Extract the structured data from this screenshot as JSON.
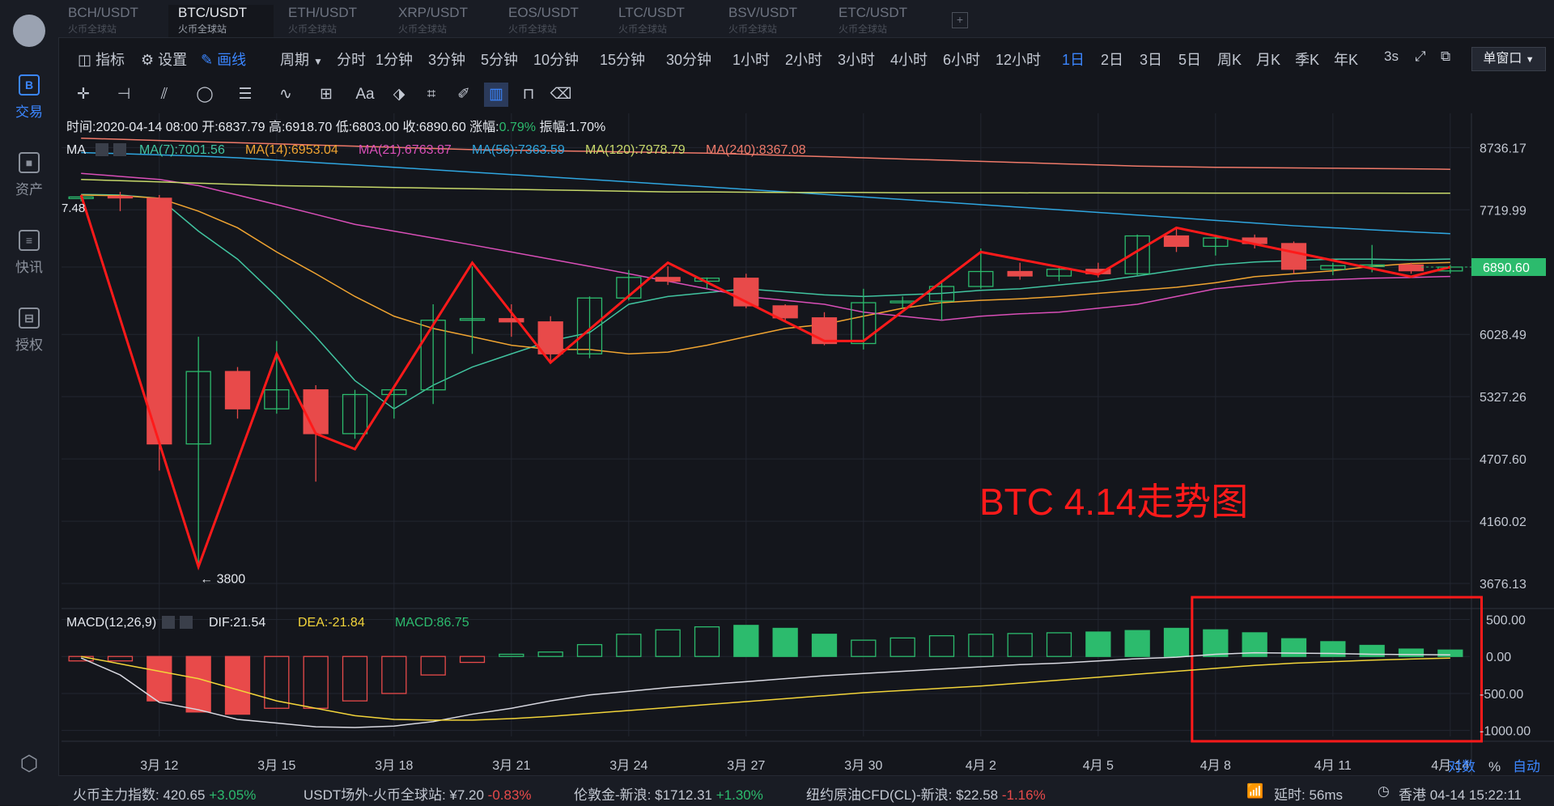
{
  "sidebar": {
    "items": [
      {
        "label": "交易",
        "icon": "B"
      },
      {
        "label": "资产",
        "icon": "■"
      },
      {
        "label": "快讯",
        "icon": "≡"
      },
      {
        "label": "授权",
        "icon": "⊟"
      }
    ]
  },
  "tabs": [
    {
      "symbol": "BCH/USDT",
      "sub": "火币全球站"
    },
    {
      "symbol": "BTC/USDT",
      "sub": "火币全球站"
    },
    {
      "symbol": "ETH/USDT",
      "sub": "火币全球站"
    },
    {
      "symbol": "XRP/USDT",
      "sub": "火币全球站"
    },
    {
      "symbol": "EOS/USDT",
      "sub": "火币全球站"
    },
    {
      "symbol": "LTC/USDT",
      "sub": "火币全球站"
    },
    {
      "symbol": "BSV/USDT",
      "sub": "火币全球站"
    },
    {
      "symbol": "ETC/USDT",
      "sub": "火币全球站"
    }
  ],
  "toolbar": {
    "indicator": "指标",
    "settings": "设置",
    "draw": "画线",
    "period": "周期",
    "periods": [
      "分时",
      "1分钟",
      "3分钟",
      "5分钟",
      "10分钟",
      "15分钟",
      "30分钟",
      "1小时",
      "2小时",
      "3小时",
      "4小时",
      "6小时",
      "12小时",
      "1日",
      "2日",
      "3日",
      "5日",
      "周K",
      "月K",
      "季K",
      "年K"
    ],
    "active_period": "1日",
    "refresh": "3s",
    "window": "单窗口"
  },
  "ohlc": {
    "time_label": "时间:",
    "time": "2020-04-14 08:00",
    "open_label": "开:",
    "open": "6837.79",
    "high_label": "高:",
    "high": "6918.70",
    "low_label": "低:",
    "low": "6803.00",
    "close_label": "收:",
    "close": "6890.60",
    "change_label": "涨幅:",
    "change": "0.79%",
    "amp_label": "振幅:",
    "amp": "1.70%"
  },
  "ma_legend": {
    "label": "MA",
    "items": [
      {
        "text": "MA(7):7001.56",
        "color": "#41c4a0"
      },
      {
        "text": "MA(14):6953.04",
        "color": "#f0a431"
      },
      {
        "text": "MA(21):6763.87",
        "color": "#d94fb8"
      },
      {
        "text": "MA(56):7363.59",
        "color": "#2fa6e0"
      },
      {
        "text": "MA(120):7978.79",
        "color": "#c7d86a"
      },
      {
        "text": "MA(240):8367.08",
        "color": "#f07a6a"
      }
    ]
  },
  "macd_legend": {
    "label": "MACD(12,26,9)",
    "dif": "DIF:21.54",
    "dea": "DEA:-21.84",
    "macd": "MACD:86.75"
  },
  "annotation": {
    "title": "BTC 4.14走势图",
    "low_mark": "← 3800",
    "left_price": "7.48"
  },
  "price_axis": [
    "8736.17",
    "7719.99",
    "6890.60",
    "6028.49",
    "5327.26",
    "4707.60",
    "4160.02",
    "3676.13"
  ],
  "current_price": "6890.60",
  "macd_axis": [
    "500.00",
    "0.00",
    "-500.00",
    "-1000.00"
  ],
  "date_axis": [
    "3月 12",
    "3月 15",
    "3月 18",
    "3月 21",
    "3月 24",
    "3月 27",
    "3月 30",
    "4月 2",
    "4月 5",
    "4月 8",
    "4月 11",
    "4月 14"
  ],
  "axis_controls": {
    "log": "对数",
    "pct": "%",
    "auto": "自动"
  },
  "footer": {
    "items": [
      {
        "label": "火币主力指数:",
        "value": "420.65",
        "change": "+3.05%",
        "dir": "pos"
      },
      {
        "label": "USDT场外-火币全球站:",
        "value": "¥7.20",
        "change": "-0.83%",
        "dir": "neg"
      },
      {
        "label": "伦敦金-新浪:",
        "value": "$1712.31",
        "change": "+1.30%",
        "dir": "pos"
      },
      {
        "label": "纽约原油CFD(CL)-新浪:",
        "value": "$22.58",
        "change": "-1.16%",
        "dir": "neg"
      }
    ],
    "latency": "延时: 56ms",
    "clock": "香港 04-14 15:22:11"
  },
  "colors": {
    "up": "#2cbb6d",
    "down": "#e84a4a",
    "accent": "#3b86ff",
    "annotation": "#ff1a1a"
  },
  "chart_data": {
    "type": "candlestick",
    "title": "BTC 4.14走势图",
    "ylim": [
      3676.13,
      8736.17
    ],
    "dates": [
      "3-10",
      "3-11",
      "3-12",
      "3-13",
      "3-14",
      "3-15",
      "3-16",
      "3-17",
      "3-18",
      "3-19",
      "3-20",
      "3-21",
      "3-22",
      "3-23",
      "3-24",
      "3-25",
      "3-26",
      "3-27",
      "3-28",
      "3-29",
      "3-30",
      "3-31",
      "4-1",
      "4-2",
      "4-3",
      "4-4",
      "4-5",
      "4-6",
      "4-7",
      "4-8",
      "4-9",
      "4-10",
      "4-11",
      "4-12",
      "4-13",
      "4-14"
    ],
    "ohlc": [
      [
        7900,
        7950,
        7850,
        7920
      ],
      [
        7930,
        8000,
        7700,
        7920
      ],
      [
        7900,
        7950,
        4600,
        4850
      ],
      [
        4850,
        6000,
        3800,
        5600
      ],
      [
        5600,
        5650,
        5100,
        5200
      ],
      [
        5200,
        5950,
        5150,
        5400
      ],
      [
        5400,
        5450,
        4500,
        4950
      ],
      [
        4950,
        5400,
        4900,
        5350
      ],
      [
        5350,
        5450,
        5100,
        5400
      ],
      [
        5400,
        6400,
        5250,
        6200
      ],
      [
        6200,
        6900,
        5800,
        6220
      ],
      [
        6220,
        6400,
        6000,
        6180
      ],
      [
        6180,
        6250,
        5700,
        5800
      ],
      [
        5800,
        6500,
        5750,
        6480
      ],
      [
        6480,
        6850,
        6450,
        6750
      ],
      [
        6750,
        6900,
        6650,
        6700
      ],
      [
        6700,
        6750,
        6600,
        6740
      ],
      [
        6740,
        6800,
        6350,
        6380
      ],
      [
        6380,
        6400,
        6200,
        6230
      ],
      [
        6230,
        6300,
        5900,
        5920
      ],
      [
        5920,
        6600,
        5850,
        6420
      ],
      [
        6420,
        6500,
        6350,
        6440
      ],
      [
        6440,
        6700,
        6200,
        6630
      ],
      [
        6630,
        7150,
        6600,
        6830
      ],
      [
        6830,
        6950,
        6720,
        6770
      ],
      [
        6770,
        6900,
        6700,
        6860
      ],
      [
        6860,
        6950,
        6750,
        6800
      ],
      [
        6800,
        7350,
        6780,
        7330
      ],
      [
        7330,
        7450,
        7100,
        7180
      ],
      [
        7180,
        7350,
        7050,
        7300
      ],
      [
        7300,
        7350,
        7150,
        7220
      ],
      [
        7220,
        7250,
        6800,
        6860
      ],
      [
        6860,
        6950,
        6780,
        6910
      ],
      [
        6910,
        7200,
        6820,
        6920
      ],
      [
        6920,
        6950,
        6800,
        6840
      ],
      [
        6837.79,
        6918.7,
        6803,
        6890.6
      ]
    ],
    "ma": {
      "MA(7)": [
        7960,
        7950,
        7900,
        7400,
        7000,
        6500,
        6000,
        5500,
        5200,
        5450,
        5650,
        5800,
        5950,
        6050,
        6400,
        6500,
        6550,
        6600,
        6560,
        6520,
        6500,
        6520,
        6540,
        6580,
        6600,
        6650,
        6700,
        6770,
        6850,
        6920,
        6960,
        6980,
        7000,
        7000,
        6990,
        7001.56
      ],
      "MA(14)": [
        7950,
        7940,
        7900,
        7700,
        7450,
        7100,
        6800,
        6500,
        6250,
        6100,
        6000,
        5900,
        5850,
        5850,
        5800,
        5820,
        5900,
        6000,
        6100,
        6150,
        6250,
        6350,
        6420,
        6450,
        6470,
        6500,
        6540,
        6580,
        6620,
        6680,
        6760,
        6800,
        6840,
        6900,
        6940,
        6953.04
      ],
      "MA(21)": [
        8300,
        8250,
        8200,
        8100,
        7950,
        7800,
        7650,
        7500,
        7400,
        7300,
        7200,
        7100,
        7000,
        6900,
        6800,
        6700,
        6600,
        6500,
        6450,
        6400,
        6300,
        6250,
        6200,
        6250,
        6280,
        6300,
        6350,
        6400,
        6500,
        6600,
        6650,
        6700,
        6720,
        6740,
        6750,
        6763.87
      ],
      "MA(56)": [
        8650,
        8630,
        8610,
        8590,
        8560,
        8520,
        8480,
        8440,
        8400,
        8360,
        8320,
        8280,
        8240,
        8200,
        8160,
        8120,
        8080,
        8040,
        8000,
        7960,
        7920,
        7880,
        7840,
        7800,
        7760,
        7720,
        7680,
        7640,
        7600,
        7560,
        7520,
        7480,
        7450,
        7420,
        7390,
        7363.59
      ],
      "MA(120)": [
        8200,
        8180,
        8160,
        8140,
        8120,
        8100,
        8090,
        8080,
        8070,
        8060,
        8050,
        8040,
        8030,
        8020,
        8010,
        8000,
        8000,
        7995,
        7990,
        7990,
        7990,
        7985,
        7985,
        7985,
        7985,
        7983,
        7983,
        7982,
        7982,
        7981,
        7981,
        7980,
        7980,
        7980,
        7979,
        7978.79
      ],
      "MA(240)": [
        8900,
        8880,
        8860,
        8840,
        8820,
        8800,
        8780,
        8760,
        8740,
        8720,
        8700,
        8690,
        8680,
        8670,
        8660,
        8650,
        8640,
        8620,
        8600,
        8580,
        8560,
        8540,
        8520,
        8500,
        8480,
        8460,
        8440,
        8420,
        8410,
        8400,
        8395,
        8390,
        8385,
        8380,
        8375,
        8367.08
      ]
    },
    "macd": {
      "ylim": [
        -1000,
        500
      ],
      "hist": [
        -60,
        -60,
        -600,
        -750,
        -780,
        -700,
        -700,
        -600,
        -500,
        -250,
        -80,
        30,
        60,
        160,
        300,
        360,
        400,
        420,
        380,
        300,
        220,
        250,
        280,
        300,
        310,
        320,
        330,
        350,
        380,
        360,
        320,
        240,
        200,
        150,
        100,
        86.75
      ],
      "dif": [
        -20,
        -250,
        -620,
        -720,
        -850,
        -900,
        -950,
        -960,
        -940,
        -880,
        -780,
        -700,
        -600,
        -520,
        -470,
        -420,
        -380,
        -340,
        -300,
        -260,
        -230,
        -200,
        -170,
        -140,
        -110,
        -90,
        -60,
        -30,
        -10,
        30,
        50,
        45,
        40,
        30,
        25,
        21.54
      ],
      "dea": [
        0,
        -100,
        -200,
        -300,
        -450,
        -600,
        -700,
        -800,
        -850,
        -860,
        -860,
        -840,
        -810,
        -770,
        -730,
        -690,
        -650,
        -610,
        -570,
        -530,
        -490,
        -460,
        -430,
        -400,
        -360,
        -320,
        -280,
        -240,
        -200,
        -160,
        -120,
        -90,
        -70,
        -50,
        -35,
        -21.84
      ]
    },
    "annotation_line": [
      [
        0,
        7950
      ],
      [
        3,
        3800
      ],
      [
        5,
        5800
      ],
      [
        5.5,
        5350
      ],
      [
        6,
        4950
      ],
      [
        7,
        4800
      ],
      [
        10,
        6950
      ],
      [
        12,
        5700
      ],
      [
        15,
        6950
      ],
      [
        19,
        5950
      ],
      [
        20,
        5950
      ],
      [
        23,
        7100
      ],
      [
        26,
        6790
      ],
      [
        28,
        7450
      ],
      [
        34,
        6760
      ],
      [
        35,
        6890
      ]
    ],
    "highlight_box": {
      "from_index": 29,
      "to_index": 35
    }
  }
}
